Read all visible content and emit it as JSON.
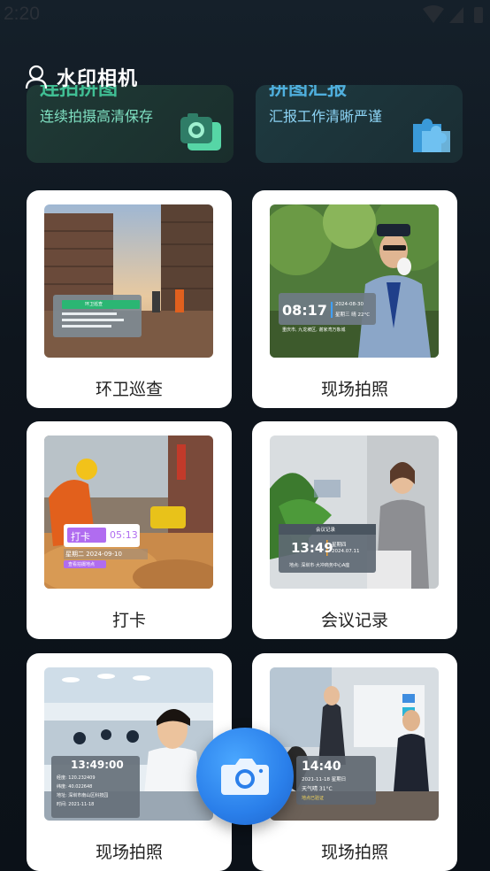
{
  "status_bar": {
    "time": "2:20"
  },
  "header": {
    "title": "水印相机"
  },
  "features": [
    {
      "title": "连拍拼图",
      "subtitle": "连续拍摄高清保存"
    },
    {
      "title": "拼图汇报",
      "subtitle": "汇报工作清晰严谨"
    }
  ],
  "cards": [
    {
      "label": "环卫巡查",
      "wm_title": "环卫巡查"
    },
    {
      "label": "现场拍照",
      "wm_time": "08:17",
      "wm_date": "2024-08-30",
      "wm_week": "星期三 晴 22°C",
      "wm_loc": "重庆市, 九龙坡区, 谢家湾万象城"
    },
    {
      "label": "打卡",
      "wm_tag": "打卡",
      "wm_time": "05:13",
      "wm_date": "星期二 2024-09-10",
      "wm_note": "查看拍摄地点"
    },
    {
      "label": "会议记录",
      "wm_title": "会议记录",
      "wm_time": "13:49",
      "wm_week": "星期四",
      "wm_date": "2024.07.11",
      "wm_loc": "地点: 深圳市·大冲商务中心A座"
    },
    {
      "label": "现场拍照",
      "wm_time": "13:49:00",
      "wm_rows": [
        "经度: 120.232409",
        "纬度: 40.022648",
        "地址: 深圳市南山区科技园",
        "时间: 2021-11-18"
      ]
    },
    {
      "label": "现场拍照",
      "wm_time": "14:40",
      "wm_date": "2021-11-18 星期日",
      "wm_weather": "天气晴 31°C",
      "wm_note": "地点已验证"
    }
  ]
}
